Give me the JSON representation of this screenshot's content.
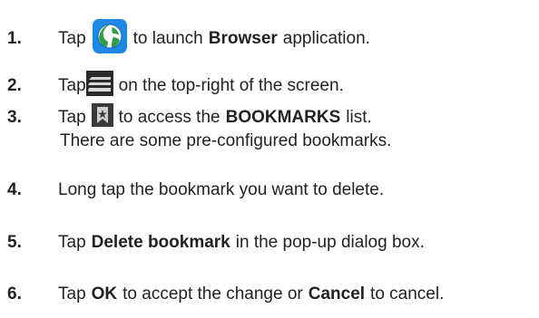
{
  "steps": [
    {
      "number": "1.",
      "parts": {
        "a": "Tap",
        "b": "to launch",
        "c": "Browser",
        "d": "application."
      },
      "icon": "browser-globe-icon",
      "icon_color": "#1e88e5"
    },
    {
      "number": "2.",
      "parts": {
        "a": "Tap",
        "b": "on the top-right of the screen."
      },
      "icon": "menu-tabs-icon"
    },
    {
      "number": "3.",
      "parts": {
        "a": "Tap",
        "b": "to access the",
        "c": "BOOKMARKS",
        "d": "list."
      },
      "icon": "bookmark-star-icon"
    },
    {
      "number": "4.",
      "parts": {
        "a": "Long tap the bookmark you want to delete."
      }
    },
    {
      "number": "5.",
      "parts": {
        "a": "Tap",
        "b": "Delete bookmark",
        "c": "in the pop-up dialog box."
      }
    },
    {
      "number": "6.",
      "parts": {
        "a": "Tap",
        "b": "OK",
        "c": "to accept the change or",
        "d": "Cancel",
        "e": "to cancel."
      }
    }
  ],
  "note": "There are some pre-configured bookmarks."
}
